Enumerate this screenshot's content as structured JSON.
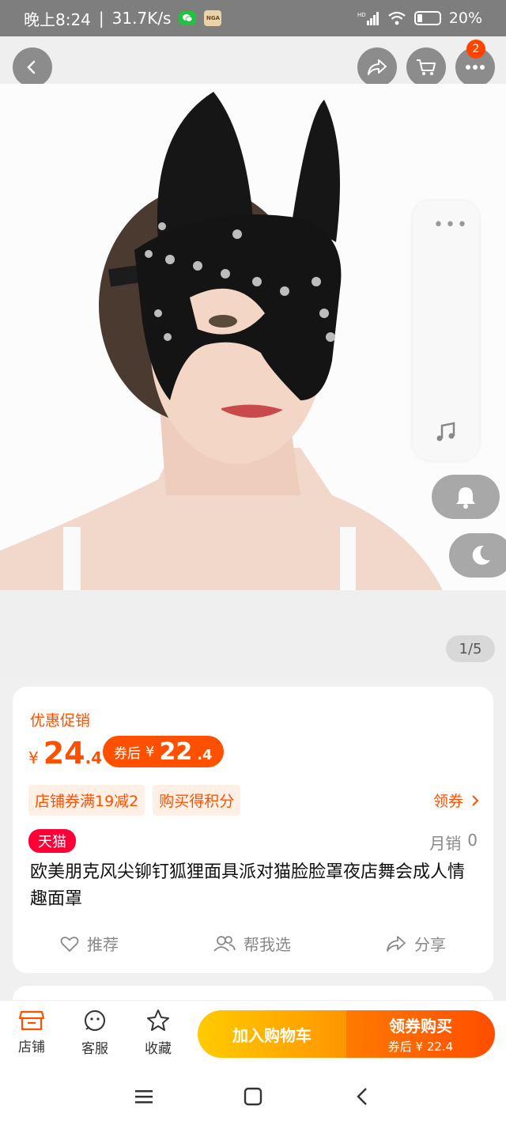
{
  "status_bar": {
    "time": "晚上8:24",
    "net_speed": "31.7K/s",
    "nga_label": "NGA",
    "battery": "20%"
  },
  "top_bar": {
    "cart_badge": "2"
  },
  "gallery": {
    "page_indicator": "1/5"
  },
  "product": {
    "promo_label": "优惠促销",
    "currency": "¥",
    "price_int": "24",
    "price_dec": ".4",
    "coupon_label": "券后",
    "coupon_price_int": "22",
    "coupon_price_dec": ".4",
    "tags": [
      "店铺券满19减2",
      "购买得积分"
    ],
    "get_coupon": "领券",
    "platform_badge": "天猫",
    "monthly_sales_label": "月销",
    "monthly_sales_value": "0",
    "title": "欧美朋克风尖铆钉狐狸面具派对猫脸脸罩夜店舞会成人情趣面罩",
    "actions": {
      "recommend": "推荐",
      "help_choose": "帮我选",
      "share": "分享"
    }
  },
  "bottom_bar": {
    "shop": "店铺",
    "service": "客服",
    "favorite": "收藏",
    "add_to_cart": "加入购物车",
    "buy_with_coupon": "领券购买",
    "buy_sub": "券后 ¥ 22.4"
  },
  "colors": {
    "accent": "#ff5000",
    "tmall": "#ff0036",
    "cart_gradient": "#ffcb00",
    "status_bar": "#7e7e7e"
  }
}
